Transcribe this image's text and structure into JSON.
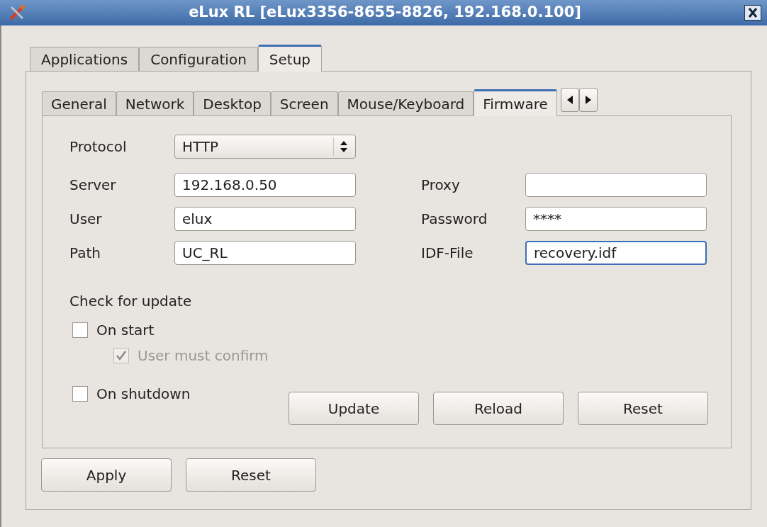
{
  "window": {
    "title": "eLux RL [eLux3356-8655-8826, 192.168.0.100]"
  },
  "tabs": [
    {
      "label": "Applications",
      "selected": false
    },
    {
      "label": "Configuration",
      "selected": false
    },
    {
      "label": "Setup",
      "selected": true
    }
  ],
  "subtabs": [
    {
      "label": "General",
      "selected": false
    },
    {
      "label": "Network",
      "selected": false
    },
    {
      "label": "Desktop",
      "selected": false
    },
    {
      "label": "Screen",
      "selected": false
    },
    {
      "label": "Mouse/Keyboard",
      "selected": false
    },
    {
      "label": "Firmware",
      "selected": true
    }
  ],
  "protocol": {
    "label": "Protocol",
    "value": "HTTP"
  },
  "fields_left": [
    {
      "label": "Server",
      "value": "192.168.0.50",
      "focused": false
    },
    {
      "label": "User",
      "value": "elux",
      "focused": false
    },
    {
      "label": "Path",
      "value": "UC_RL",
      "focused": false
    }
  ],
  "fields_right": [
    {
      "label": "Proxy",
      "focused": false
    },
    {
      "label": "Password",
      "value": "****",
      "focused": false
    },
    {
      "label": "IDF-File",
      "value": "recovery.idf",
      "focused": true
    }
  ],
  "update_check": {
    "heading": "Check for update",
    "options": [
      {
        "label": "On start",
        "checked": false,
        "disabled": false,
        "children": [
          {
            "label": "User must confirm",
            "checked": true,
            "disabled": true
          }
        ]
      },
      {
        "label": "On shutdown",
        "checked": false,
        "disabled": false
      }
    ]
  },
  "panel_buttons": [
    "Update",
    "Reload",
    "Reset"
  ],
  "buttons": [
    "Apply",
    "Reset"
  ]
}
